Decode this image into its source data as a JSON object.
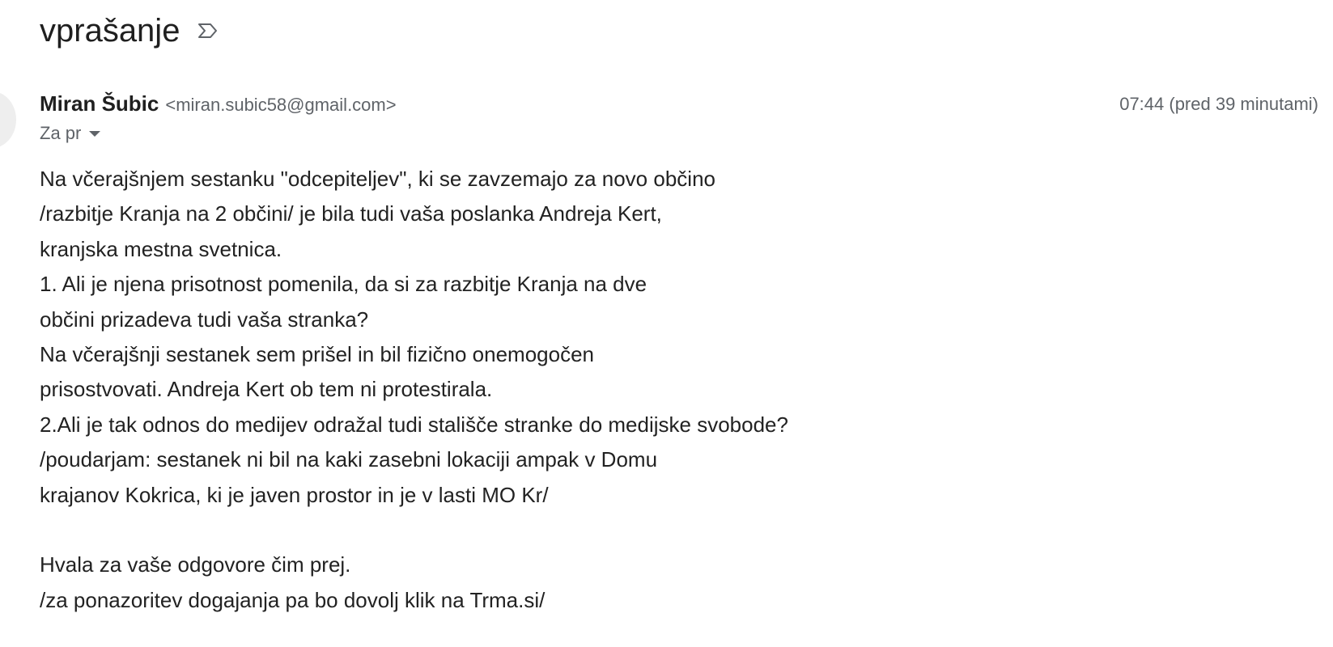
{
  "email": {
    "subject": "vprašanje",
    "label_icon": "label-outline-icon",
    "sender": {
      "name": "Miran Šubic",
      "email": "<miran.subic58@gmail.com>"
    },
    "timestamp": "07:44 (pred 39 minutami)",
    "recipients_label": "Za pr",
    "body_lines": [
      "Na včerajšnjem sestanku \"odcepiteljev\", ki se zavzemajo za novo občino",
      "/razbitje Kranja na 2 občini/ je bila tudi vaša poslanka Andreja Kert,",
      "kranjska mestna svetnica.",
      "1. Ali je njena prisotnost pomenila, da si za razbitje Kranja na dve",
      "občini prizadeva tudi vaša stranka?",
      "Na včerajšnji sestanek sem prišel in bil fizično onemogočen",
      "prisostvovati. Andreja Kert ob tem ni protestirala.",
      "2.Ali je tak odnos do medijev odražal tudi stališče stranke do medijske svobode?",
      "/poudarjam: sestanek ni bil na kaki zasebni lokaciji ampak v Domu",
      "krajanov Kokrica, ki je javen prostor in je v lasti MO Kr/",
      "",
      "Hvala za vaše odgovore čim prej.",
      "/za ponazoritev dogajanja pa bo dovolj klik na Trma.si/"
    ]
  }
}
